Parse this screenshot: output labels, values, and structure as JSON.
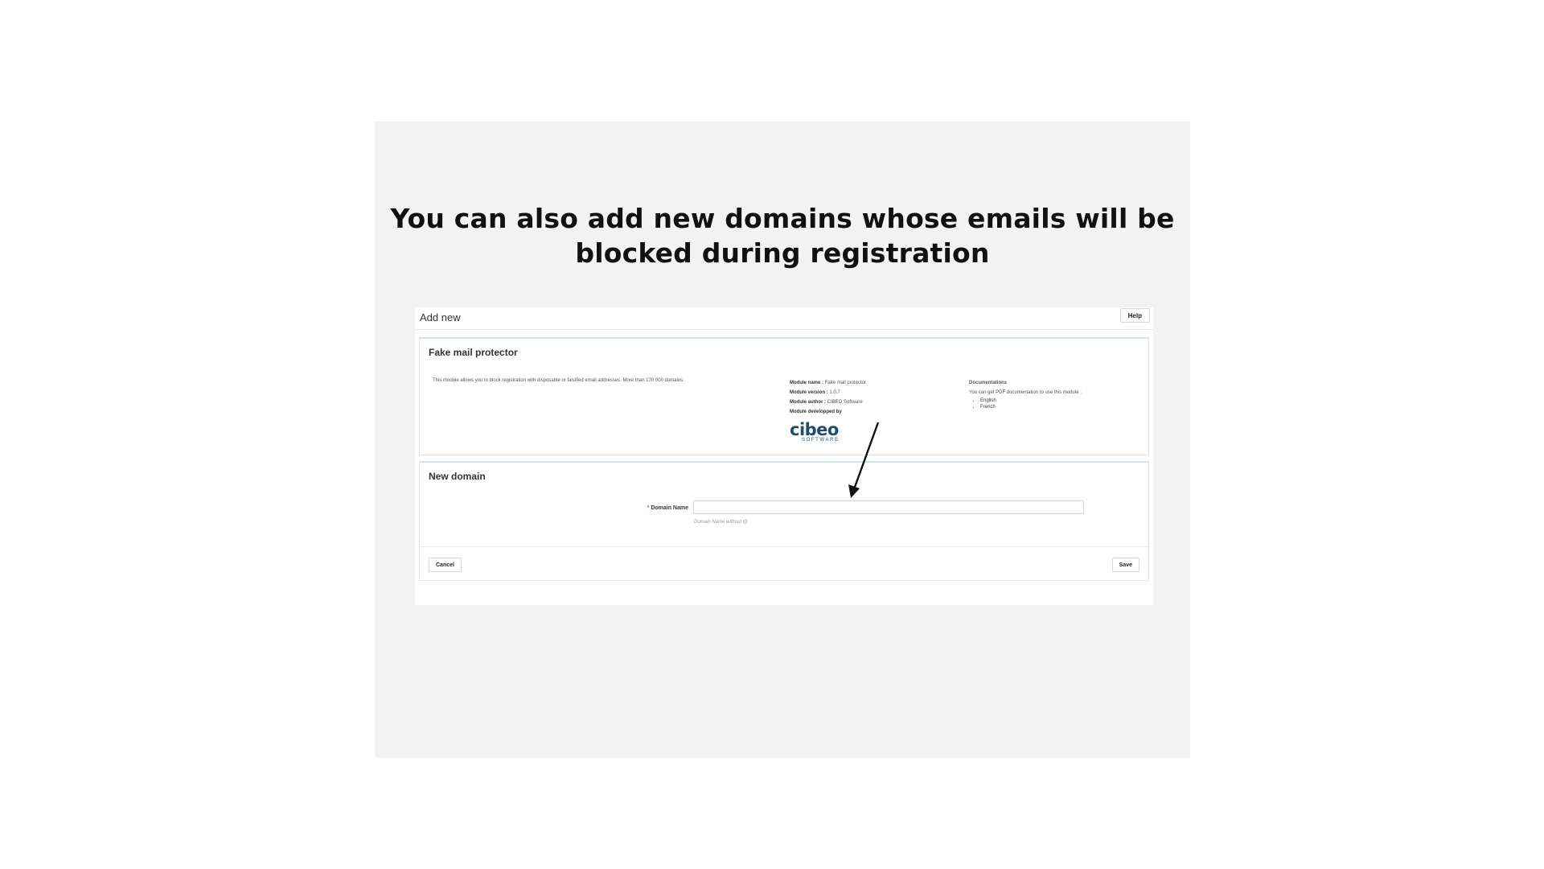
{
  "slide": {
    "headline_line1": "You can also add new domains whose emails will be",
    "headline_line2": "blocked during registration"
  },
  "page": {
    "title": "Add new",
    "help_label": "Help"
  },
  "module_panel": {
    "title": "Fake mail protector",
    "description": "This module allows you to block registration with disposable or falsified email addresses. More than 170 000 domains.",
    "module_name_label": "Module name :",
    "module_name_value": "Fake mail protector",
    "module_version_label": "Module version :",
    "module_version_value": "1.0.7",
    "module_author_label": "Module author :",
    "module_author_value": "CIBEO Software",
    "developed_by_label": "Module developped by",
    "logo_text": "cibeo",
    "logo_subtext": "SOFTWARE",
    "docs_title": "Documentations",
    "docs_text": "You can get PDF documentation to use this module :",
    "docs_links": [
      "English",
      "French"
    ]
  },
  "new_domain_panel": {
    "title": "New domain",
    "required_mark": "*",
    "field_label": "Domain Name",
    "field_value": "",
    "field_placeholder": "",
    "field_help": "Domain Name without @",
    "cancel_label": "Cancel",
    "save_label": "Save"
  },
  "colors": {
    "slide_background": "#f2f2f2",
    "panel_accent": "#cfe6ea",
    "logo": "#1e4d6e",
    "required": "#d9534f"
  }
}
